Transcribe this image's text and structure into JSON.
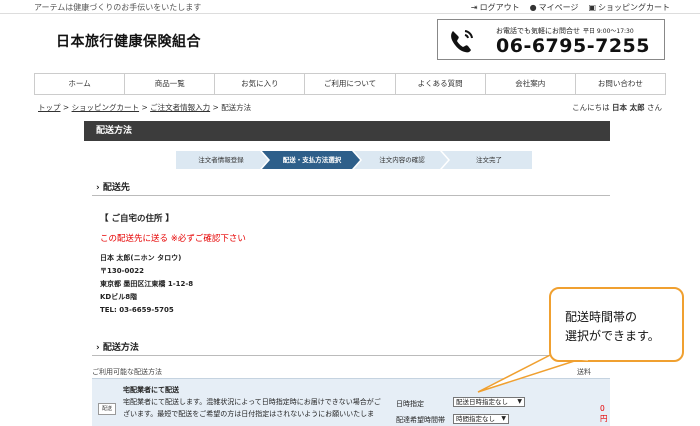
{
  "header": {
    "tagline": "アーテムは健康づくりのお手伝いをいたします",
    "links": [
      {
        "icon": "logout-icon",
        "glyph": "⇥",
        "label": "ログアウト"
      },
      {
        "icon": "user-icon",
        "glyph": "👤",
        "label": "マイページ"
      },
      {
        "icon": "cart-icon",
        "glyph": "🛒",
        "label": "ショッピングカート"
      }
    ],
    "site_title": "日本旅行健康保険組合",
    "phone": {
      "note": "お電話でも気軽にお問合せ",
      "hours": "平日 9:00～17:30",
      "number": "06-6795-7255"
    }
  },
  "nav": [
    "ホーム",
    "商品一覧",
    "お気に入り",
    "ご利用について",
    "よくある質問",
    "会社案内",
    "お問い合わせ"
  ],
  "breadcrumb": {
    "items": [
      "トップ",
      "ショッピングカート",
      "ご注文者情報入力"
    ],
    "current": "配送方法",
    "sep": " > "
  },
  "greeting": {
    "prefix": "こんにちは",
    "name": "日本 太郎",
    "suffix": "さん"
  },
  "section_title": "配送方法",
  "steps": [
    "注文者情報登録",
    "配送・支払方法選択",
    "注文内容の確認",
    "注文完了"
  ],
  "active_step": 1,
  "destination": {
    "heading": "配送先",
    "address_title": "【 ご自宅の住所 】",
    "ship_here": "この配送先に送る ※必ずご確認下さい",
    "lines": [
      "日本 太郎(ニホン タロウ)",
      "〒130-0022",
      "東京都 墨田区江東橋 1-12-8",
      "KDビル8階",
      "TEL: 03-6659-5705"
    ]
  },
  "shipping": {
    "heading": "配送方法",
    "available_label": "ご利用可能な配送方法",
    "fee_label": "送料",
    "carrier": {
      "logo": "配送",
      "name": "宅配業者にて配送",
      "desc": "宅配業者にて配送します。混雑状況によって日時指定時にお届けできない場合がございます。最短で配送をご希望の方は日付指定はされないようにお願いいたしま",
      "date_label": "日時指定",
      "date_value": "配送日時指定なし",
      "time_label": "配達希望時間帯",
      "time_value": "時間指定なし",
      "fee": "0円"
    }
  },
  "callout": {
    "line1": "配送時間帯の",
    "line2": "選択ができます。"
  },
  "colors": {
    "accent_red": "#e60000",
    "header_dark": "#3c3c3c",
    "step_active": "#2e5f8a",
    "step_inactive": "#dce8f2",
    "callout_border": "#f0a030"
  }
}
